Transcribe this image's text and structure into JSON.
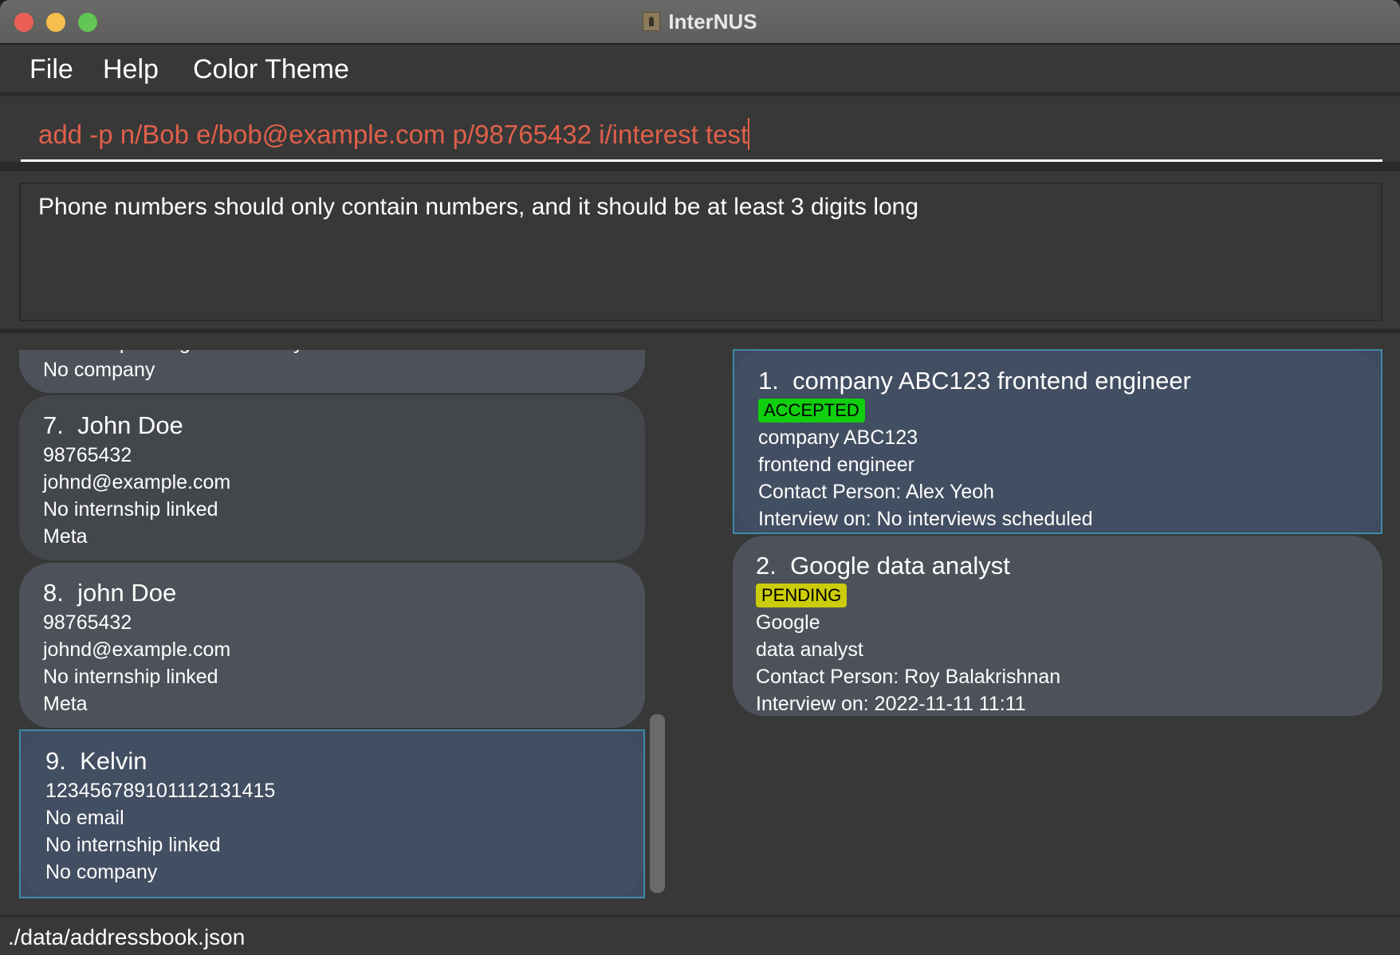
{
  "window": {
    "title": "InterNUS",
    "traffic_lights": {
      "close": "#ec5f57",
      "minimize": "#f5bf4f",
      "zoom": "#62c655"
    }
  },
  "menu": {
    "items": [
      "File",
      "Help",
      "Color Theme"
    ]
  },
  "command": {
    "value": "add -p n/Bob e/bob@example.com p/98765432 i/interest test",
    "text_color": "#e0604a"
  },
  "result": {
    "message": "Phone numbers should only contain numbers, and it should be at least 3 digits long"
  },
  "persons": [
    {
      "partial": true,
      "lines": [
        "Internship: Google data analyst",
        "No company"
      ]
    },
    {
      "index": "7.",
      "name": "John Doe",
      "lines": [
        "98765432",
        "johnd@example.com",
        "No internship linked",
        "Meta"
      ]
    },
    {
      "index": "8.",
      "name": "john Doe",
      "lines": [
        "98765432",
        "johnd@example.com",
        "No internship linked",
        "Meta"
      ]
    },
    {
      "index": "9.",
      "name": "Kelvin",
      "selected": true,
      "lines": [
        "123456789101112131415",
        "No email",
        "No internship linked",
        "No company"
      ]
    }
  ],
  "internships": [
    {
      "index": "1.",
      "title": "company ABC123 frontend engineer",
      "status": "ACCEPTED",
      "status_color": "#0fcf0f",
      "selected": true,
      "lines": [
        "company ABC123",
        "frontend engineer",
        "Contact Person: Alex Yeoh",
        "Interview on: No interviews scheduled"
      ]
    },
    {
      "index": "2.",
      "title": "Google data analyst",
      "status": "PENDING",
      "status_color": "#cccc0a",
      "lines": [
        "Google",
        "data analyst",
        "Contact Person: Roy Balakrishnan",
        "Interview on: 2022-11-11 11:11"
      ]
    }
  ],
  "status_bar": {
    "path": "./data/addressbook.json"
  }
}
